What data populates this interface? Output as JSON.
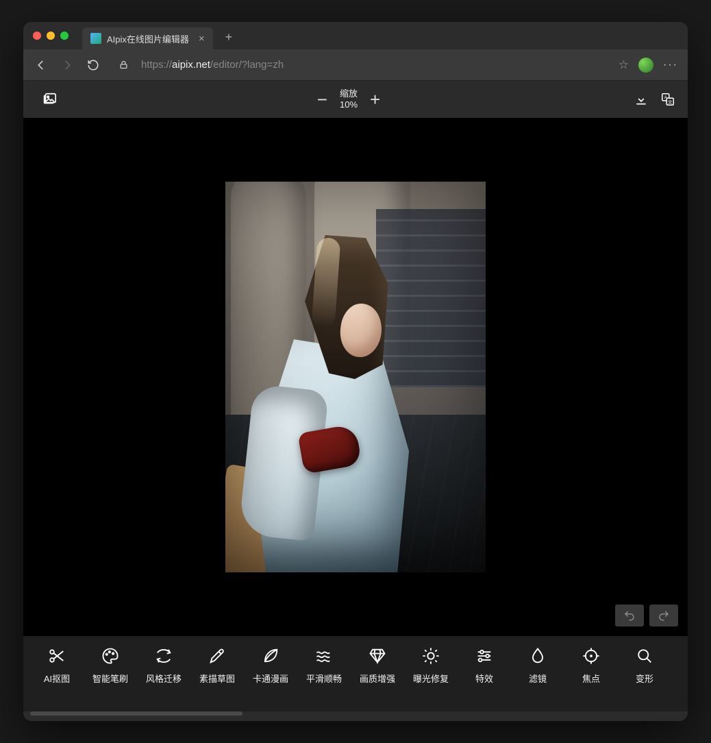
{
  "browser": {
    "tab_title": "AIpix在线图片编辑器",
    "url_proto": "https://",
    "url_host": "aipix.net",
    "url_path": "/editor/?lang=zh"
  },
  "toolbar": {
    "zoom_label": "缩放",
    "zoom_value": "10%"
  },
  "tools": [
    {
      "id": "ai-cutout",
      "label": "AI抠图",
      "icon": "scissors"
    },
    {
      "id": "smart-brush",
      "label": "智能笔刷",
      "icon": "palette"
    },
    {
      "id": "style-trans",
      "label": "风格迁移",
      "icon": "swap"
    },
    {
      "id": "sketch",
      "label": "素描草图",
      "icon": "pencil"
    },
    {
      "id": "cartoon",
      "label": "卡通漫画",
      "icon": "leaf"
    },
    {
      "id": "smooth",
      "label": "平滑顺畅",
      "icon": "waves"
    },
    {
      "id": "enhance",
      "label": "画质增强",
      "icon": "diamond"
    },
    {
      "id": "exposure",
      "label": "曝光修复",
      "icon": "sun"
    },
    {
      "id": "effects",
      "label": "特效",
      "icon": "sliders"
    },
    {
      "id": "filters",
      "label": "滤镜",
      "icon": "drop"
    },
    {
      "id": "focus",
      "label": "焦点",
      "icon": "target"
    },
    {
      "id": "transform",
      "label": "变形",
      "icon": "magnify"
    }
  ]
}
